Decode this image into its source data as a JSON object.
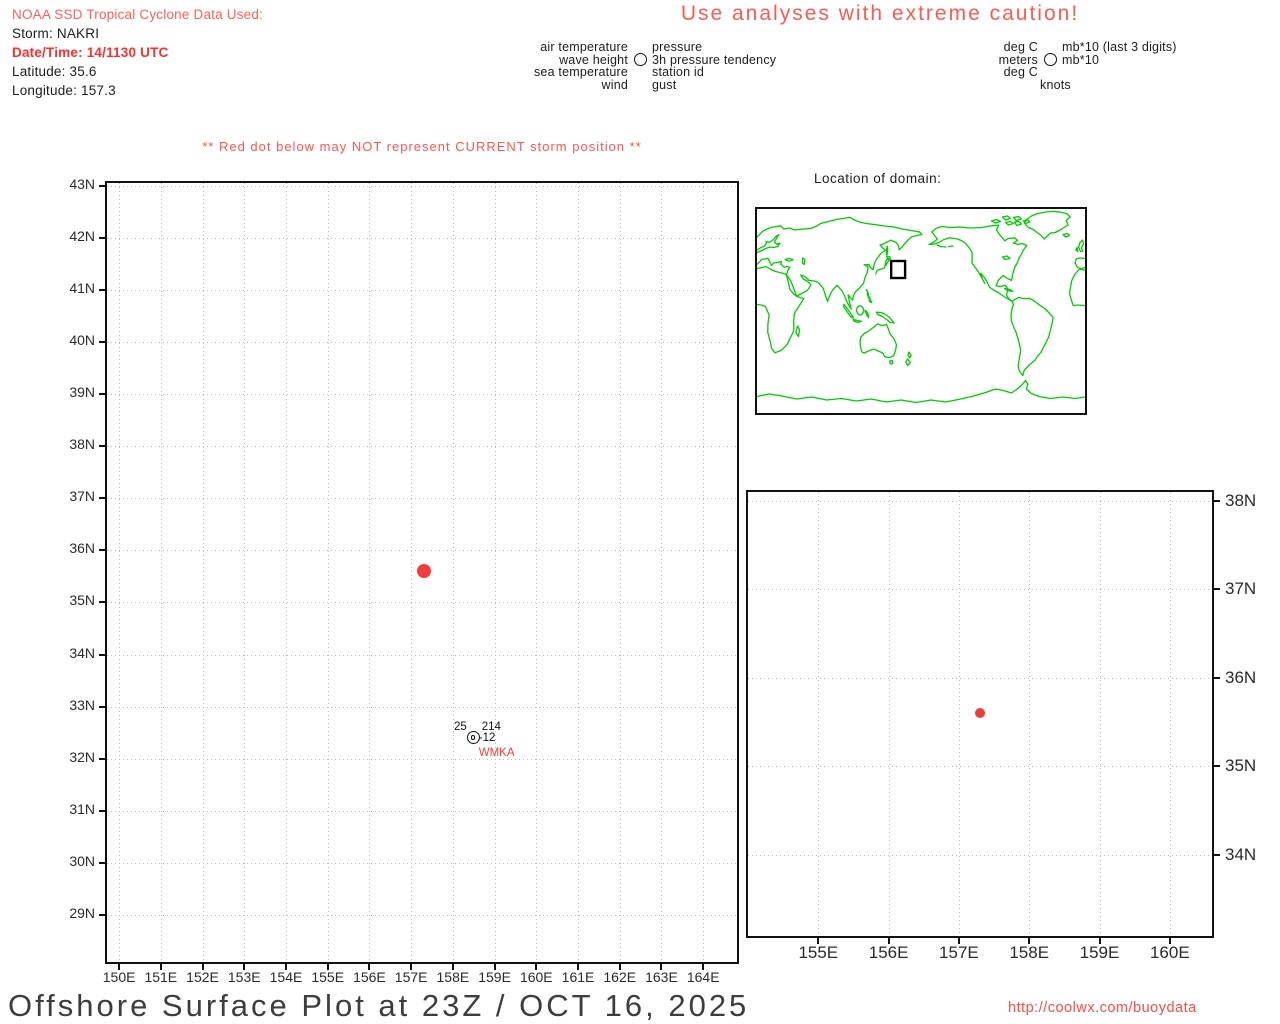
{
  "header": {
    "source_line": "NOAA SSD Tropical Cyclone Data Used:",
    "storm_line": "Storm: NAKRI",
    "datetime_line": "Date/Time: 14/1130 UTC",
    "latitude_line": "Latitude: 35.6",
    "longitude_line": "Longitude: 157.3",
    "caution": "Use analyses with extreme caution!"
  },
  "legend": {
    "station_model_rows": [
      {
        "left": "air temperature",
        "right": "pressure",
        "circle": false
      },
      {
        "left": "wave height",
        "right": "3h pressure tendency",
        "circle": true
      },
      {
        "left": "sea temperature",
        "right": "station id",
        "circle": false
      },
      {
        "left": "wind",
        "right": "gust",
        "circle": false
      }
    ],
    "units_model_rows": [
      {
        "left": "deg C",
        "right": "mb*10 (last 3 digits)",
        "circle": false
      },
      {
        "left": "meters",
        "right": "mb*10",
        "circle": true
      },
      {
        "left": "deg C",
        "right": "",
        "circle": false
      },
      {
        "left": "",
        "right": "knots",
        "circle": false
      }
    ]
  },
  "warning": "** Red dot below may NOT represent CURRENT storm position **",
  "domain_inset": {
    "title": "Location of domain:"
  },
  "footer": {
    "title": "Offshore Surface Plot at 23Z / OCT 16, 2025",
    "url": "http://coolwx.com/buoydata"
  },
  "colors": {
    "red_text_light": "#ff6057",
    "red_text_bold": "#ff2e2e",
    "caution_red": "#ff5a52",
    "storm_dot_red": "#f23b3b",
    "station_id_red": "#f43b36",
    "map_green": "#00cc00",
    "grid_gray": "#b9b9b9"
  },
  "chart_data": [
    {
      "type": "scatter",
      "title": "main offshore surface plot (lat/lon map)",
      "x_tick_labels": [
        "150E",
        "151E",
        "152E",
        "153E",
        "154E",
        "155E",
        "156E",
        "157E",
        "158E",
        "159E",
        "160E",
        "161E",
        "162E",
        "163E",
        "164E"
      ],
      "y_tick_labels": [
        "43N",
        "42N",
        "41N",
        "40N",
        "39N",
        "38N",
        "37N",
        "36N",
        "35N",
        "34N",
        "33N",
        "32N",
        "31N",
        "30N",
        "29N"
      ],
      "xlim": [
        149.71,
        164.81
      ],
      "ylim": [
        28.1,
        43.05
      ],
      "grid": "dotted gray lines at 1-degree intervals",
      "legend_position": "none",
      "points": [
        {
          "name": "storm-position-dot",
          "lon": 157.3,
          "lat": 35.6,
          "color": "#f23b3b"
        }
      ],
      "stations": [
        {
          "id": "WMKA",
          "lon": 158.5,
          "lat": 32.4,
          "air_temperature": "25",
          "pressure": "214",
          "pressure_tendency": "-12"
        }
      ]
    },
    {
      "type": "scatter",
      "title": "zoomed domain plot (lat/lon map)",
      "x_tick_labels": [
        "155E",
        "156E",
        "157E",
        "158E",
        "159E",
        "160E"
      ],
      "y_tick_labels": [
        "38N",
        "37N",
        "36N",
        "35N",
        "34N"
      ],
      "xlim": [
        154.0,
        160.6
      ],
      "ylim": [
        33.08,
        38.1
      ],
      "grid": "dotted gray lines at 1-degree intervals",
      "legend_position": "none",
      "points": [
        {
          "name": "storm-position-dot",
          "lon": 157.3,
          "lat": 35.6,
          "color": "#f23b3b"
        }
      ],
      "stations": []
    }
  ]
}
